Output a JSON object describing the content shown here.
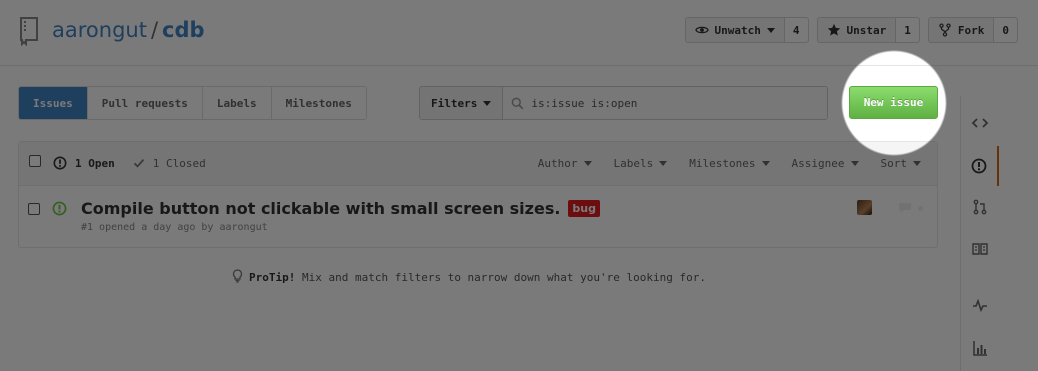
{
  "repo": {
    "owner": "aarongut",
    "separator": "/",
    "name": "cdb"
  },
  "actions": [
    {
      "label": "Unwatch",
      "count": "4",
      "icon": "eye-icon"
    },
    {
      "label": "Unstar",
      "count": "1",
      "icon": "star-icon"
    },
    {
      "label": "Fork",
      "count": "0",
      "icon": "fork-icon"
    }
  ],
  "subnav": [
    "Issues",
    "Pull requests",
    "Labels",
    "Milestones"
  ],
  "filters": {
    "button": "Filters",
    "query": "is:issue is:open"
  },
  "new_issue": "New issue",
  "table": {
    "open": "1 Open",
    "closed": "1 Closed",
    "sorts": [
      "Author",
      "Labels",
      "Milestones",
      "Assignee",
      "Sort"
    ]
  },
  "issues": [
    {
      "title": "Compile button not clickable with small screen sizes.",
      "label": "bug",
      "label_color": "#e11d21",
      "meta": "#1 opened a day ago by aarongut"
    }
  ],
  "protip": {
    "prefix": "ProTip!",
    "text": " Mix and match filters to narrow down what you're looking for."
  },
  "colors": {
    "accent": "#4183c4",
    "new_issue_green": "#60b044",
    "open_green": "#6cc644",
    "sidebar_selected": "#d26911"
  },
  "sidebar_icons": [
    "code-icon",
    "issue-icon",
    "pull-request-icon",
    "wiki-icon",
    "pulse-icon",
    "graph-icon"
  ]
}
